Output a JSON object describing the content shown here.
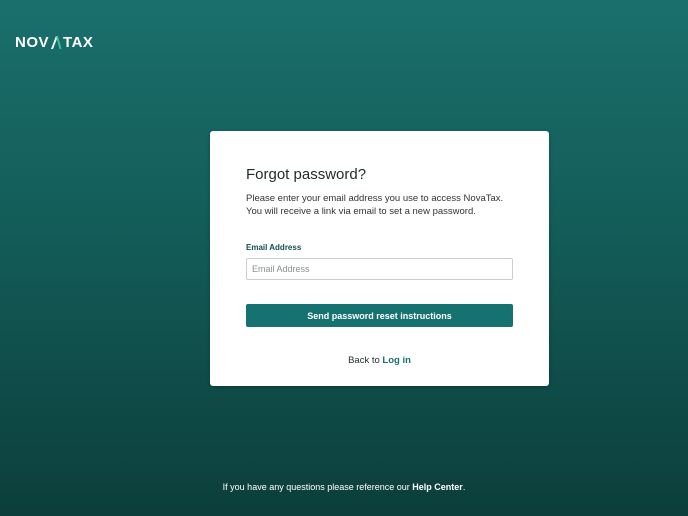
{
  "brand": {
    "logo_text_left": "NOV",
    "logo_text_right": "TAX",
    "accent_color": "#33c49a"
  },
  "card": {
    "title": "Forgot password?",
    "description_line1": "Please enter your email address you use to access NovaTax.",
    "description_line2": "You will receive a link via email to set a new password.",
    "email_label": "Email Address",
    "email_placeholder": "Email Address",
    "email_value": "",
    "send_button_label": "Send password reset instructions",
    "back_prefix": "Back to",
    "login_link": "Log in"
  },
  "footer": {
    "text": "If you have any questions please reference our",
    "help_link": "Help Center",
    "suffix": "."
  },
  "colors": {
    "background_top": "#1a6f6c",
    "background_bottom": "#0c3e3b",
    "button": "#167270",
    "link": "#167270"
  }
}
